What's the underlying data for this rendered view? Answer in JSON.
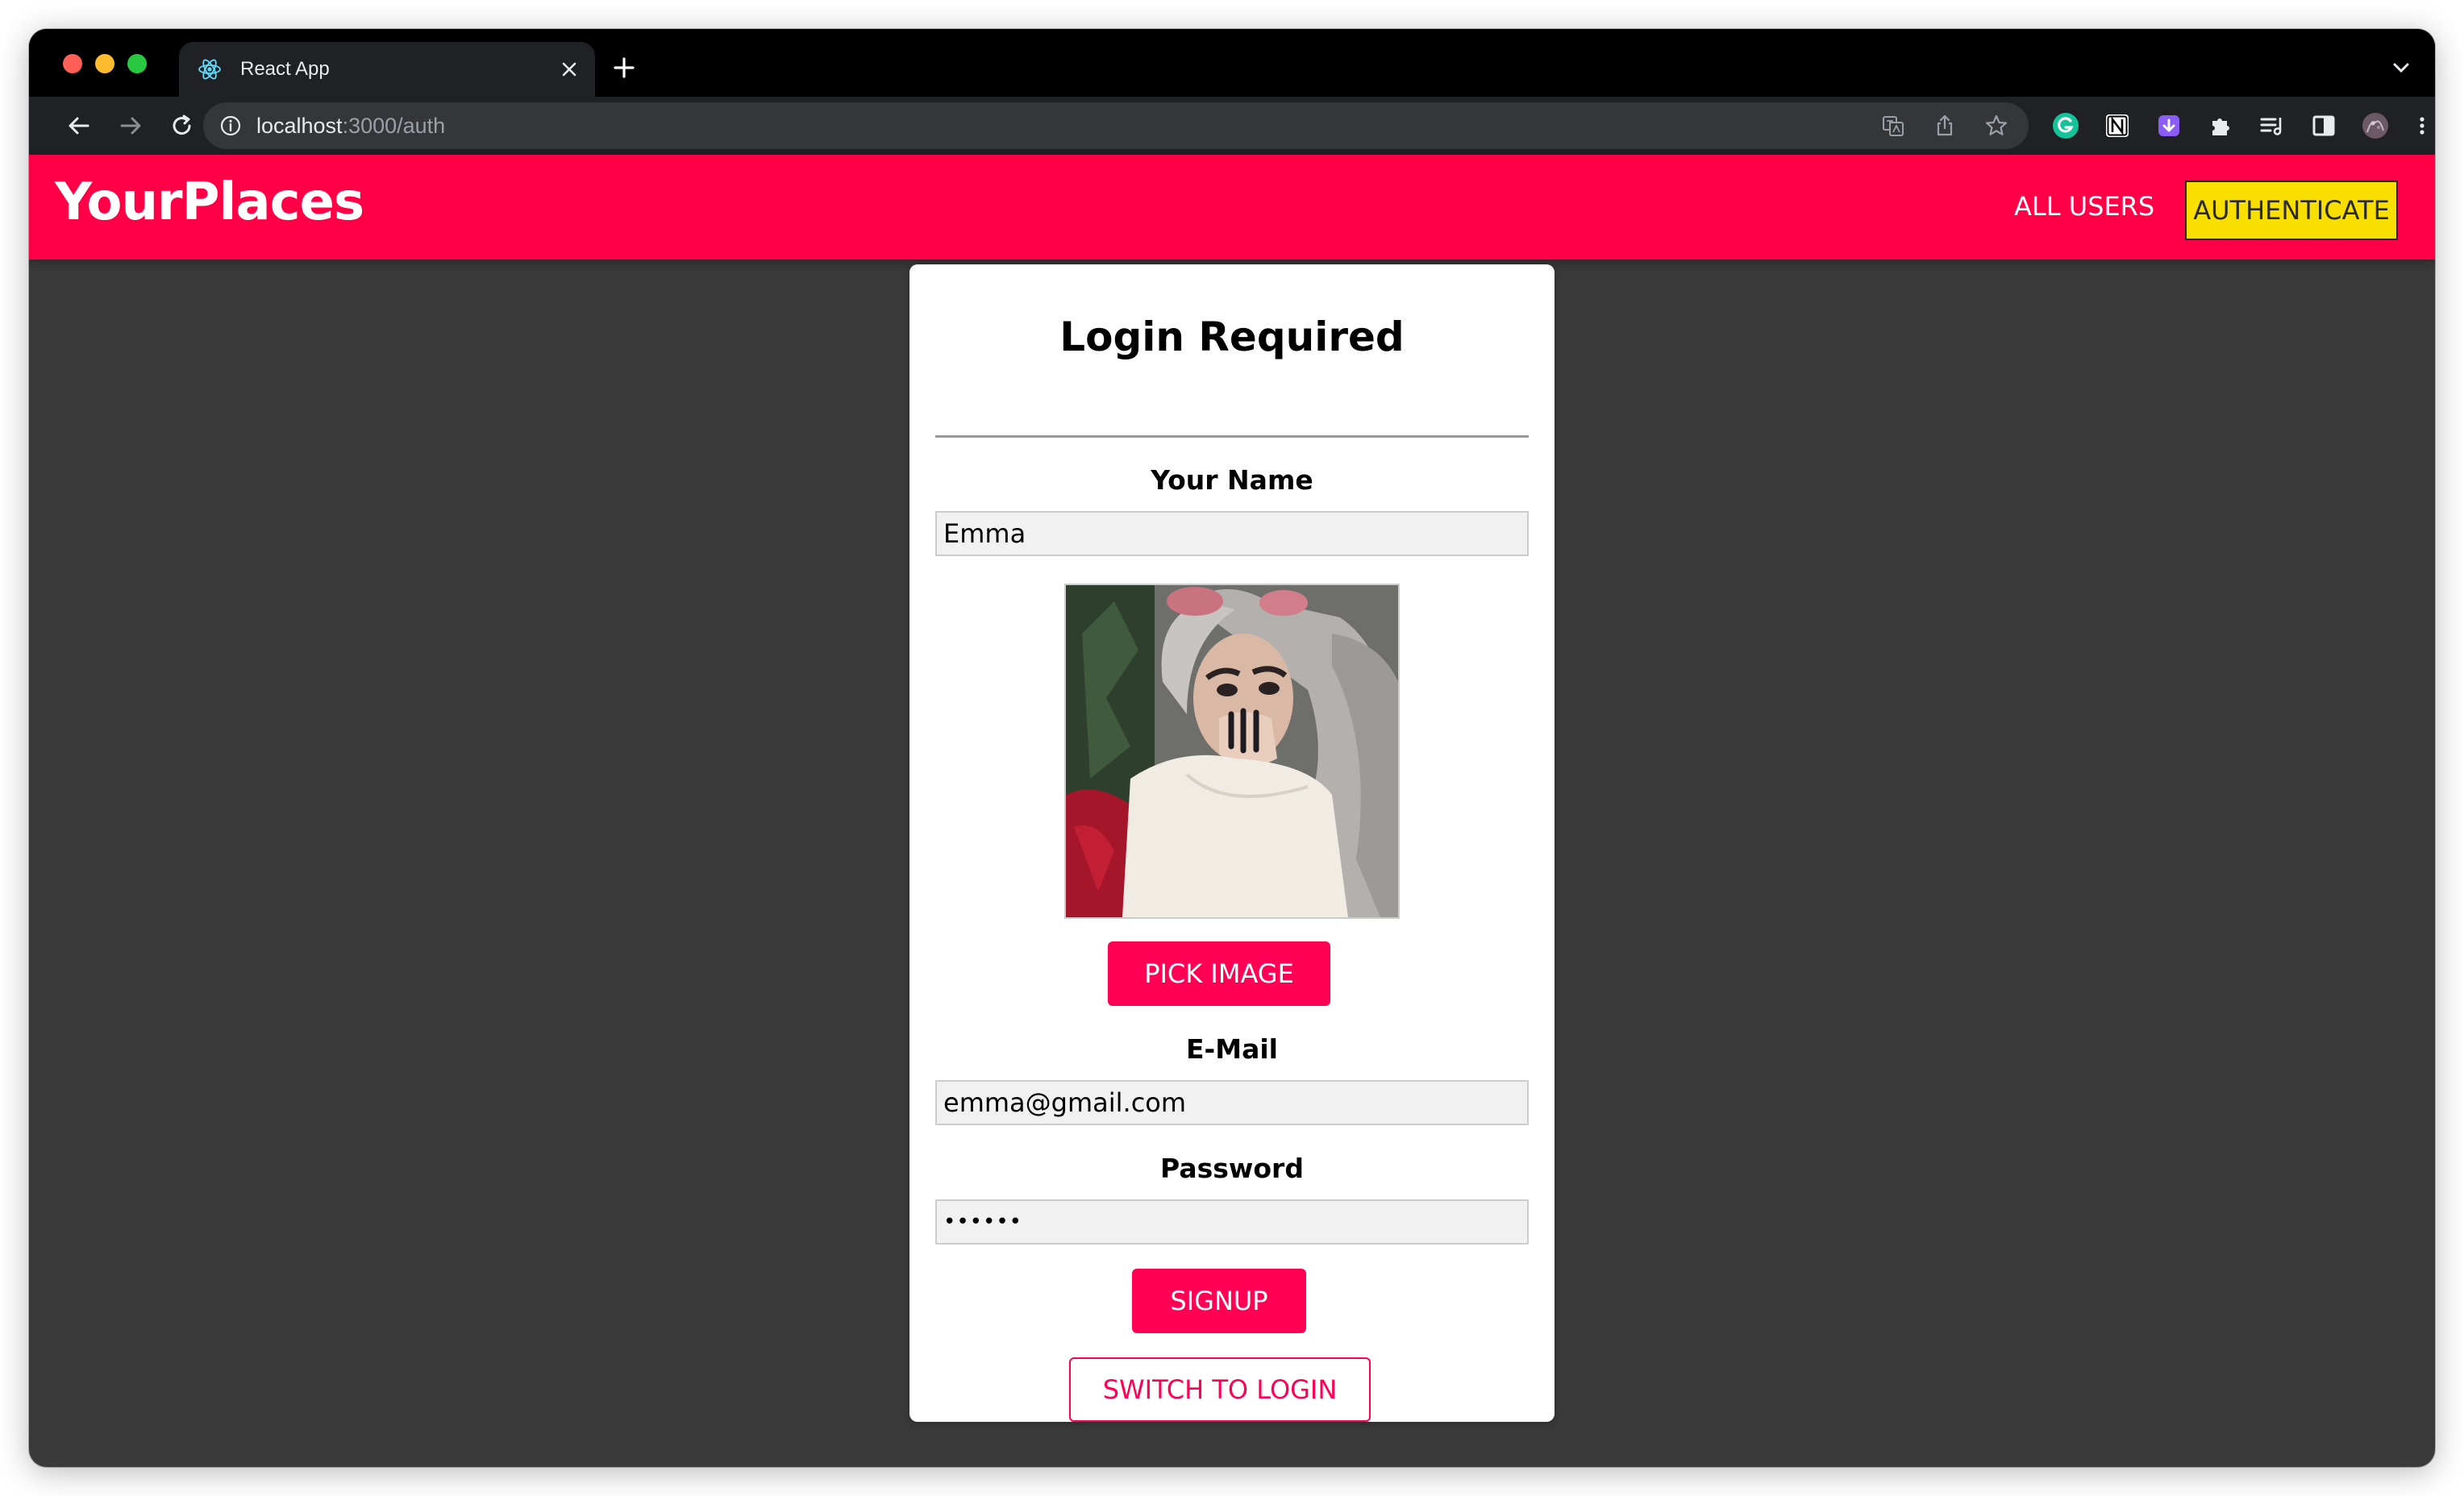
{
  "browser": {
    "tab_title": "React App",
    "url_host": "localhost",
    "url_rest": ":3000/auth"
  },
  "header": {
    "brand": "YourPlaces",
    "nav": {
      "all_users": "ALL USERS",
      "authenticate": "AUTHENTICATE"
    }
  },
  "auth": {
    "title": "Login Required",
    "name_label": "Your Name",
    "name_value": "Emma",
    "pick_image": "PICK IMAGE",
    "email_label": "E-Mail",
    "email_value": "emma@gmail.com",
    "password_label": "Password",
    "password_value": "••••••",
    "submit": "SIGNUP",
    "switch_mode": "SWITCH TO LOGIN"
  },
  "colors": {
    "header_bg": "#ff0046",
    "primary": "#ff0055",
    "auth_button": "#f8df00",
    "page_bg": "#3a3a3a"
  }
}
